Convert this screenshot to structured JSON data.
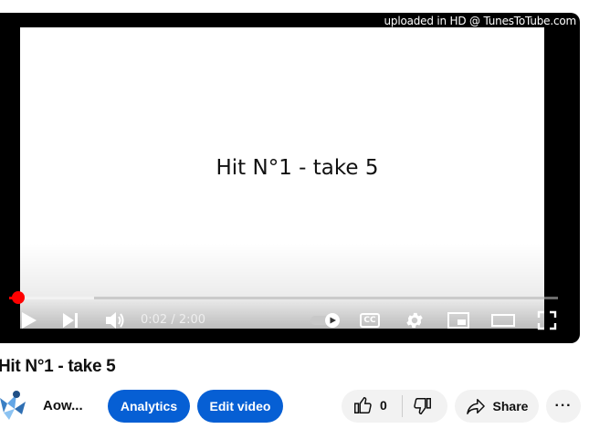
{
  "player": {
    "watermark": "uploaded in HD @ TunesToTube.com",
    "frame_text": "Hit N°1 - take 5",
    "progress": {
      "played_fraction": 0.0167,
      "buffered_fraction": 0.155
    },
    "time_display": "0:02 / 2:00",
    "controls": [
      "play-icon",
      "next-icon",
      "volume-icon",
      "autoplay-toggle",
      "subtitles-icon",
      "settings-gear-icon",
      "miniplayer-icon",
      "theater-mode-icon",
      "fullscreen-icon"
    ],
    "subtitles_label": "CC",
    "accent_color": "#ff0000"
  },
  "video": {
    "title": "Hit N°1 - take 5",
    "channel_name": "Aow...",
    "analytics_label": "Analytics",
    "edit_label": "Edit video",
    "like_count": "0",
    "share_label": "Share",
    "more_label": "···",
    "button_color": "#065fd4"
  }
}
